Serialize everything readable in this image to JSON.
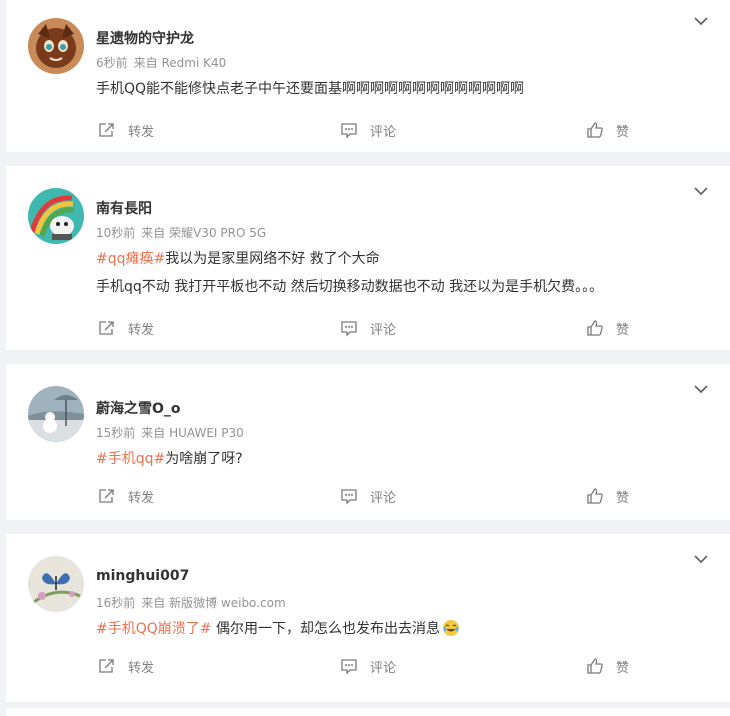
{
  "actions": {
    "share": "转发",
    "comment": "评论",
    "like": "赞"
  },
  "posts": [
    {
      "name": "星遗物的守护龙",
      "time": "6秒前",
      "source": "来自 Redmi K40",
      "line1": "手机QQ能不能修快点老子中午还要面基啊啊啊啊啊啊啊啊啊啊啊啊啊",
      "avatar_icon": "fox-cartoon-avatar"
    },
    {
      "name": "南有長阳",
      "time": "10秒前",
      "source": "来自 荣耀V30 PRO 5G",
      "topic": "#qq瘫痪#",
      "line1_rest": "我以为是家里网络不好 救了个大命",
      "line2": "手机qq不动 我打开平板也不动 然后切换移动数据也不动 我还以为是手机欠费。。。",
      "avatar_icon": "rainbow-cartoon-avatar"
    },
    {
      "name": "蔚海之雪O_o",
      "time": "15秒前",
      "source": "来自 HUAWEI P30",
      "topic": "#手机qq#",
      "line1_rest": "为啥崩了呀?",
      "avatar_icon": "snow-scene-avatar"
    },
    {
      "name": "minghui007",
      "time": "16秒前",
      "source": "来自 新版微博 weibo.com",
      "topic": "#手机QQ崩溃了#",
      "line1_rest": " 偶尔用一下，却怎么也发布出去消息",
      "emoji": "laugh-cry-emoji",
      "avatar_icon": "butterfly-avatar"
    }
  ],
  "colors": {
    "topic": "#eb7350",
    "meta": "#939393",
    "background": "#f1f2f5"
  }
}
